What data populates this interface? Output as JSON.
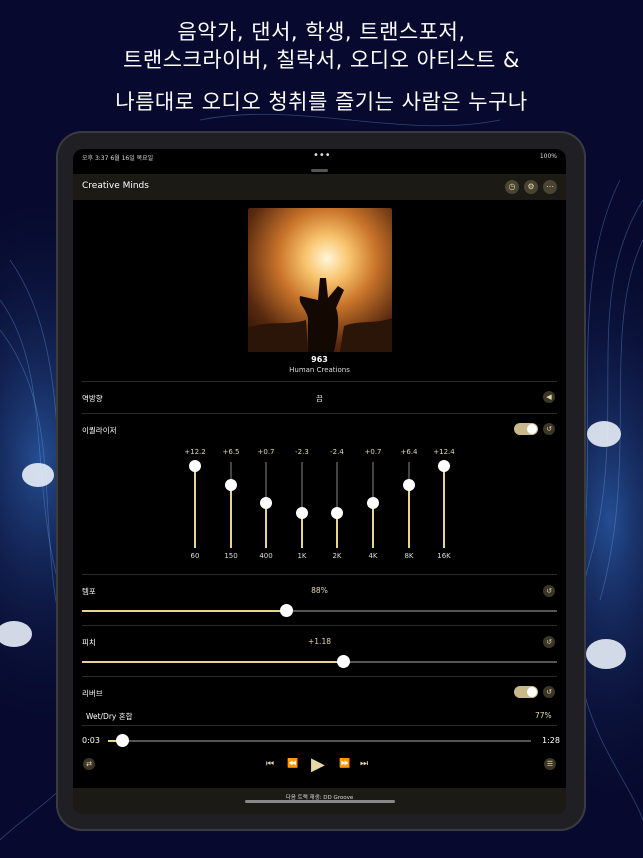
{
  "headline": {
    "line1": "음악가, 댄서, 학생, 트랜스포저,",
    "line2": "트랜스크라이버, 칠락서, 오디오 아티스트 &",
    "line3": "나름대로 오디오 청취를 즐기는 사람은 누구나"
  },
  "status": {
    "time": "오후 3:37   6월 16일 목요일",
    "dots": "•••",
    "battery": "100%"
  },
  "nav": {
    "title": "Creative Minds",
    "icons": [
      "timer-icon",
      "settings-icon",
      "more-icon"
    ]
  },
  "track": {
    "title": "963",
    "artist": "Human Creations"
  },
  "reverse": {
    "label": "역방향",
    "value": "끔"
  },
  "equalizer": {
    "label": "이퀄라이저",
    "enabled": true,
    "bands": [
      {
        "freq": "60",
        "gain": "+12.2",
        "level": 0.95
      },
      {
        "freq": "150",
        "gain": "+6.5",
        "level": 0.73
      },
      {
        "freq": "400",
        "gain": "+0.7",
        "level": 0.52
      },
      {
        "freq": "1K",
        "gain": "-2.3",
        "level": 0.41
      },
      {
        "freq": "2K",
        "gain": "-2.4",
        "level": 0.41
      },
      {
        "freq": "4K",
        "gain": "+0.7",
        "level": 0.52
      },
      {
        "freq": "8K",
        "gain": "+6.4",
        "level": 0.73
      },
      {
        "freq": "16K",
        "gain": "+12.4",
        "level": 0.95
      }
    ]
  },
  "tempo": {
    "label": "템포",
    "value": "88%",
    "level": 0.43
  },
  "pitch": {
    "label": "피치",
    "value": "+1.18",
    "level": 0.55
  },
  "reverb": {
    "label": "리버브",
    "enabled": true,
    "mix_label": "Wet/Dry 혼합",
    "mix_value": "77%"
  },
  "playback": {
    "elapsed": "0:03",
    "total": "1:28",
    "progress": 0.034
  },
  "bottom": {
    "next_text": "다음 트랙 재생: DD Groove"
  },
  "colors": {
    "accent": "#e8d48a",
    "bg": "#000000",
    "bar": "#1c1a14"
  }
}
